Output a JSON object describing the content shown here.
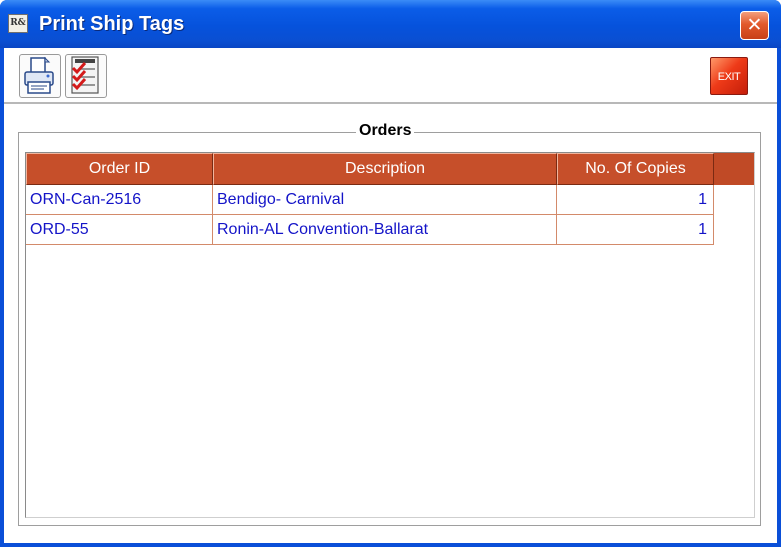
{
  "window": {
    "title": "Print Ship Tags",
    "icon_label": "R&",
    "close_glyph": "✕"
  },
  "toolbar": {
    "print_icon": "printer-icon",
    "check_icon": "checklist-icon",
    "exit_label": "EXIT"
  },
  "orders": {
    "group_title": "Orders",
    "columns": [
      "Order ID",
      "Description",
      "No. Of Copies"
    ],
    "rows": [
      {
        "order_id": "ORN-Can-2516",
        "description": "Bendigo- Carnival",
        "copies": "1"
      },
      {
        "order_id": "ORD-55",
        "description": "Ronin-AL Convention-Ballarat",
        "copies": "1"
      }
    ]
  },
  "colors": {
    "title_bar": "#0652dc",
    "header_fill": "#c64f2a",
    "cell_text": "#1414c8",
    "grid_line": "#d38a6a"
  }
}
